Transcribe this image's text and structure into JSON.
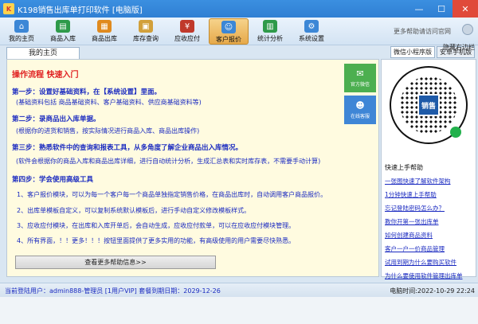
{
  "window": {
    "title": "K198销售出库单打印软件 [电脑版]",
    "app_icon_text": "K"
  },
  "toolbar": {
    "items": [
      {
        "label": "我的主页",
        "icon": "home-icon",
        "color": "#3c87d6"
      },
      {
        "label": "商品入库",
        "icon": "stock-in-icon",
        "color": "#2e9a4a"
      },
      {
        "label": "商品出库",
        "icon": "stock-out-icon",
        "color": "#e08a1e"
      },
      {
        "label": "库存查询",
        "icon": "inventory-icon",
        "color": "#d2a03a"
      },
      {
        "label": "应收应付",
        "icon": "finance-icon",
        "color": "#c0392b"
      },
      {
        "label": "客户报价",
        "icon": "quote-icon",
        "color": "#3c87d6"
      },
      {
        "label": "统计分析",
        "icon": "chart-icon",
        "color": "#2e9a4a"
      },
      {
        "label": "系统设置",
        "icon": "settings-icon",
        "color": "#3c87d6"
      }
    ],
    "more_link": "更多帮助请访问官网",
    "hide_right": "隐藏右边栏"
  },
  "tabs": {
    "home": "我的主页",
    "mini_program": "微信小程序版",
    "android": "安卓手机版"
  },
  "main": {
    "heading": "操作流程 快速入门",
    "step1": "第一步：设置好基础资料，在【系统设置】里面。",
    "note1": "(基础资料包括 商品基础资料、客户基础资料、供应商基础资料等)",
    "step2": "第二步：录商品出入库单据。",
    "note2": "(根据你的进货和销售，按实际情况进行商品入库、商品出库操作)",
    "step3": "第三步：熟悉软件中的查询和报表工具，从多角度了解企业商品出入库情况。",
    "note3": "(软件会根据你的商品入库和商品出库详细，进行自动统计分析，生成汇总表和实时库存表，不需要手动计算)",
    "step4": "第四步：学会使用高级工具",
    "list1": "1、客户报价模块，可以为每一个客户每一个商品单独指定销售价格，在商品出库时，自动调用客户商品报价。",
    "list2": "2、出库单模板自定义，可以复制系统默认模板后，进行手动自定义修改模板样式。",
    "list3": "3、应收应付模块，在出库和入库开单后，会自动生成，应收应付款单，可以在应收应付模块管理。",
    "list4": "4、所有界面，！！更多！！！按钮里面提供了更多实用的功能，有高级使用的用户需要尽快熟悉。",
    "more_help_button": "查看更多帮助信息>>",
    "float_wechat": "官方微信",
    "float_qq": "在线客服"
  },
  "right": {
    "qr_logo": "销售",
    "section_title": "快速上手帮助",
    "links": [
      "一张图快速了解软件架构",
      "1分钟快速上手帮助",
      "忘记登陆密码怎么办？",
      "教你开第一张出库单",
      "如何创建商品资料",
      "客户一户一价商品管理",
      "试用到期为什么要购买软件",
      "为什么要使用软件管理出库单"
    ]
  },
  "status": {
    "login_info": "当前登陆用户：admin888-管理员 [1用户VIP] 套餐到期日期：2029-12-26",
    "time": "电脑时间:2022-10-29 22:24"
  }
}
